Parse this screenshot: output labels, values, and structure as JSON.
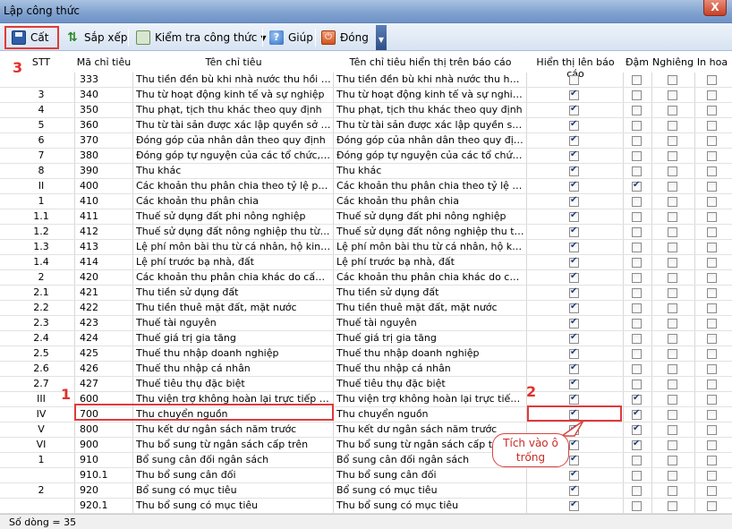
{
  "window": {
    "title": "Lập công thức",
    "close_label": "X"
  },
  "toolbar": {
    "save_label": "Cất",
    "sort_label": "Sắp xếp",
    "check_label": "Kiểm tra công thức",
    "help_label": "Giúp",
    "close_label": "Đóng"
  },
  "columns": {
    "stt": "STT",
    "ma_chi_tieu": "Mã chỉ tiêu",
    "ten_chi_tieu": "Tên chỉ tiêu",
    "ten_hien_thi": "Tên chỉ tiêu hiển thị trên báo cáo",
    "hien_thi": "Hiển thị lên báo cáo",
    "dam": "Đậm",
    "nghieng": "Nghiêng",
    "in_hoa": "In hoa"
  },
  "rows": [
    {
      "stt": "",
      "code": "333",
      "name": "Thu tiền đền bù khi nhà nước thu hồi đất",
      "display": "Thu tiền đền bù khi nhà nước thu hồi đất",
      "show": false,
      "bold": false,
      "italic": false,
      "upper": false
    },
    {
      "stt": "3",
      "code": "340",
      "name": "Thu từ hoạt động kinh tế và sự nghiệp",
      "display": "Thu từ hoạt động kinh tế và sự nghiệp",
      "show": true,
      "bold": false,
      "italic": false,
      "upper": false
    },
    {
      "stt": "4",
      "code": "350",
      "name": "Thu phạt, tịch thu khác theo quy định",
      "display": "Thu phạt, tịch thu khác theo quy định",
      "show": true,
      "bold": false,
      "italic": false,
      "upper": false
    },
    {
      "stt": "5",
      "code": "360",
      "name": "Thu từ tài sản được xác lập quyền sở hữu...",
      "display": "Thu từ tài sản được xác lập quyền sở hữ...",
      "show": true,
      "bold": false,
      "italic": false,
      "upper": false
    },
    {
      "stt": "6",
      "code": "370",
      "name": "Đóng góp của nhân dân theo quy định",
      "display": "Đóng góp của nhân dân theo quy định",
      "show": true,
      "bold": false,
      "italic": false,
      "upper": false
    },
    {
      "stt": "7",
      "code": "380",
      "name": "Đóng góp tự nguyện của các tổ chức, cá n...",
      "display": "Đóng góp tự nguyện của các tổ chức, cá...",
      "show": true,
      "bold": false,
      "italic": false,
      "upper": false
    },
    {
      "stt": "8",
      "code": "390",
      "name": "Thu khác",
      "display": "Thu khác",
      "show": true,
      "bold": false,
      "italic": false,
      "upper": false
    },
    {
      "stt": "II",
      "code": "400",
      "name": "Các khoản thu phân chia theo tỷ lệ phần t...",
      "display": "Các khoản thu phân chia theo tỷ lệ phần...",
      "show": true,
      "bold": true,
      "italic": false,
      "upper": false
    },
    {
      "stt": "1",
      "code": "410",
      "name": "Các khoản thu phân chia",
      "display": "Các khoản thu phân chia",
      "show": true,
      "bold": false,
      "italic": false,
      "upper": false
    },
    {
      "stt": "1.1",
      "code": "411",
      "name": "Thuế sử dụng đất phi nông nghiệp",
      "display": "Thuế sử dụng đất phi nông nghiệp",
      "show": true,
      "bold": false,
      "italic": false,
      "upper": false
    },
    {
      "stt": "1.2",
      "code": "412",
      "name": "Thuế sử dụng đất nông nghiệp thu từ hộ g...",
      "display": "Thuế sử dụng đất nông nghiệp thu từ hộ...",
      "show": true,
      "bold": false,
      "italic": false,
      "upper": false
    },
    {
      "stt": "1.3",
      "code": "413",
      "name": "Lệ phí môn bài thu từ cá nhân, hộ kinh do...",
      "display": "Lệ phí môn bài thu từ cá nhân, hộ kinh d...",
      "show": true,
      "bold": false,
      "italic": false,
      "upper": false
    },
    {
      "stt": "1.4",
      "code": "414",
      "name": "Lệ phí trước bạ nhà, đất",
      "display": "Lệ phí trước bạ nhà, đất",
      "show": true,
      "bold": false,
      "italic": false,
      "upper": false
    },
    {
      "stt": "2",
      "code": "420",
      "name": "Các khoản thu phân chia khác do cấp tỉnh...",
      "display": "Các khoản thu phân chia khác do cấp tỉn...",
      "show": true,
      "bold": false,
      "italic": false,
      "upper": false
    },
    {
      "stt": "2.1",
      "code": "421",
      "name": "Thu tiền sử dụng đất",
      "display": "Thu tiền sử dụng đất",
      "show": true,
      "bold": false,
      "italic": false,
      "upper": false
    },
    {
      "stt": "2.2",
      "code": "422",
      "name": "Thu tiền thuê mặt đất, mặt nước",
      "display": "Thu tiền thuê mặt đất, mặt nước",
      "show": true,
      "bold": false,
      "italic": false,
      "upper": false
    },
    {
      "stt": "2.3",
      "code": "423",
      "name": "Thuế tài nguyên",
      "display": "Thuế tài nguyên",
      "show": true,
      "bold": false,
      "italic": false,
      "upper": false
    },
    {
      "stt": "2.4",
      "code": "424",
      "name": "Thuế giá trị gia tăng",
      "display": "Thuế giá trị gia tăng",
      "show": true,
      "bold": false,
      "italic": false,
      "upper": false
    },
    {
      "stt": "2.5",
      "code": "425",
      "name": "Thuế thu nhập doanh nghiệp",
      "display": "Thuế thu nhập doanh nghiệp",
      "show": true,
      "bold": false,
      "italic": false,
      "upper": false
    },
    {
      "stt": "2.6",
      "code": "426",
      "name": "Thuế thu nhập cá nhân",
      "display": "Thuế thu nhập cá nhân",
      "show": true,
      "bold": false,
      "italic": false,
      "upper": false
    },
    {
      "stt": "2.7",
      "code": "427",
      "name": "Thuế tiêu thụ đặc biệt",
      "display": "Thuế tiêu thụ đặc biệt",
      "show": true,
      "bold": false,
      "italic": false,
      "upper": false
    },
    {
      "stt": "III",
      "code": "600",
      "name": "Thu viện trợ không hoàn lại trực tiếp cho x...",
      "display": "Thu viện trợ không hoàn lại trực tiếp cho...",
      "show": true,
      "bold": true,
      "italic": false,
      "upper": false
    },
    {
      "stt": "IV",
      "code": "700",
      "name": "Thu chuyển nguồn",
      "display": "Thu chuyển nguồn",
      "show": true,
      "bold": true,
      "italic": false,
      "upper": false
    },
    {
      "stt": "V",
      "code": "800",
      "name": "Thu kết dư ngân sách năm trước",
      "display": "Thu kết dư ngân sách năm trước",
      "show": true,
      "bold": true,
      "italic": false,
      "upper": false
    },
    {
      "stt": "VI",
      "code": "900",
      "name": "Thu bổ sung từ ngân sách cấp trên",
      "display": "Thu bổ sung từ ngân sách cấp trên",
      "show": true,
      "bold": true,
      "italic": false,
      "upper": false
    },
    {
      "stt": "1",
      "code": "910",
      "name": "Bổ sung cân đối ngân sách",
      "display": "Bổ sung cân đối ngân sách",
      "show": true,
      "bold": false,
      "italic": false,
      "upper": false
    },
    {
      "stt": "",
      "code": "910.1",
      "name": "Thu bổ sung cân đối",
      "display": "Thu bổ sung cân đối",
      "show": true,
      "bold": false,
      "italic": false,
      "upper": false
    },
    {
      "stt": "2",
      "code": "920",
      "name": "Bổ sung có mục tiêu",
      "display": "Bổ sung có mục tiêu",
      "show": true,
      "bold": false,
      "italic": false,
      "upper": false
    },
    {
      "stt": "",
      "code": "920.1",
      "name": "Thu bổ sung có mục tiêu",
      "display": "Thu bổ sung có mục tiêu",
      "show": true,
      "bold": false,
      "italic": false,
      "upper": false
    }
  ],
  "status": {
    "row_count": "Số dòng = 35"
  },
  "annotations": {
    "marker_1": "1",
    "marker_2": "2",
    "marker_3": "3",
    "callout": "Tích vào ô trống",
    "color": "#e03a3a"
  }
}
